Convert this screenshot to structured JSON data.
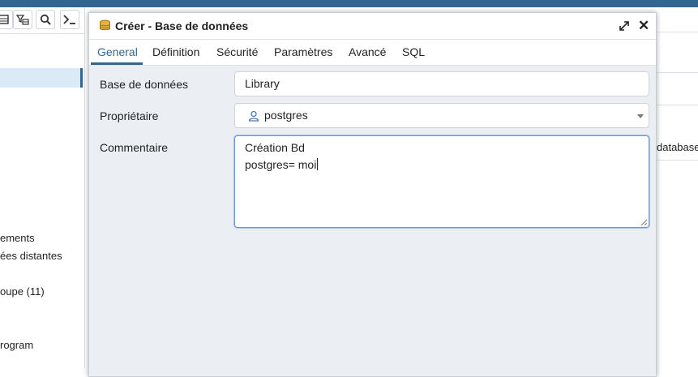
{
  "background": {
    "toolbar_icons": [
      "table-icon",
      "filter-table-icon",
      "search-icon",
      "terminal-icon"
    ],
    "tree_items": [
      "ements",
      "ées distantes",
      "oupe (11)",
      "rogram"
    ],
    "right_text": "database"
  },
  "dialog": {
    "title": "Créer - Base de données",
    "icon": "database-icon",
    "tabs": [
      {
        "label": "General",
        "active": true
      },
      {
        "label": "Définition"
      },
      {
        "label": "Sécurité"
      },
      {
        "label": "Paramètres"
      },
      {
        "label": "Avancé"
      },
      {
        "label": "SQL"
      }
    ],
    "fields": {
      "database": {
        "label": "Base de données",
        "value": "Library"
      },
      "owner": {
        "label": "Propriétaire",
        "value": "postgres",
        "icon": "user-icon"
      },
      "comment": {
        "label": "Commentaire",
        "lines": [
          "Création Bd",
          "postgres= moi"
        ]
      }
    }
  },
  "colors": {
    "accent": "#326690",
    "dialog_bg": "#ebeef3",
    "focus_border": "#6b9bd1"
  }
}
